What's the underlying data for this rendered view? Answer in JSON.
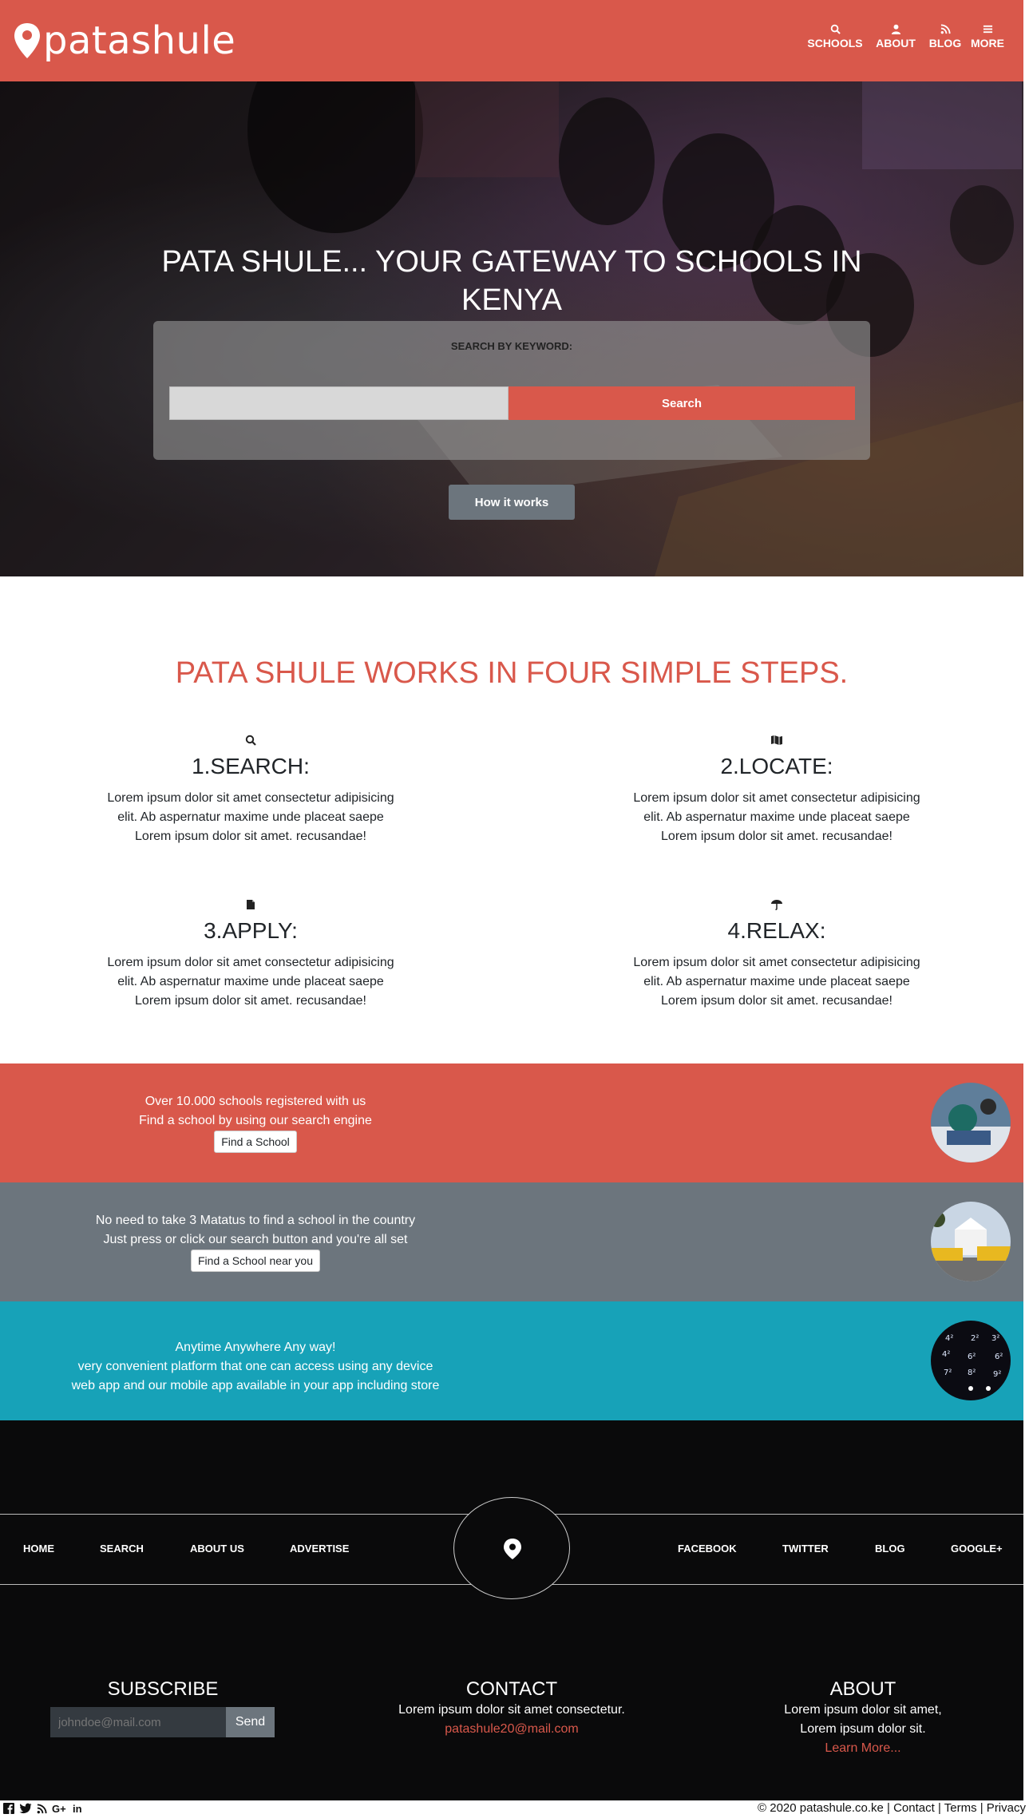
{
  "brand": {
    "name": "patashule",
    "color": "#d9584b"
  },
  "nav": {
    "items": [
      {
        "label": "SCHOOLS",
        "icon": "search-icon"
      },
      {
        "label": "ABOUT",
        "icon": "user-icon"
      },
      {
        "label": "BLOG",
        "icon": "rss-icon"
      },
      {
        "label": "MORE",
        "icon": "menu-icon"
      }
    ]
  },
  "hero": {
    "title": "PATA SHULE... YOUR GATEWAY TO SCHOOLS IN KENYA",
    "search_label": "SEARCH BY KEYWORD:",
    "search_placeholder": "",
    "search_button": "Search",
    "how_button": "How it works"
  },
  "steps": {
    "title": "PATA SHULE WORKS IN FOUR SIMPLE STEPS.",
    "items": [
      {
        "heading": "1.SEARCH:",
        "icon": "search-icon",
        "text": "Lorem ipsum dolor sit amet consectetur adipisicing elit. Ab aspernatur maxime unde placeat saepe Lorem ipsum dolor sit amet. recusandae!"
      },
      {
        "heading": "2.LOCATE:",
        "icon": "map-icon",
        "text": "Lorem ipsum dolor sit amet consectetur adipisicing elit. Ab aspernatur maxime unde placeat saepe Lorem ipsum dolor sit amet. recusandae!"
      },
      {
        "heading": "3.APPLY:",
        "icon": "file-icon",
        "text": "Lorem ipsum dolor sit amet consectetur adipisicing elit. Ab aspernatur maxime unde placeat saepe Lorem ipsum dolor sit amet. recusandae!"
      },
      {
        "heading": "4.RELAX:",
        "icon": "umbrella-icon",
        "text": "Lorem ipsum dolor sit amet consectetur adipisicing elit. Ab aspernatur maxime unde placeat saepe Lorem ipsum dolor sit amet. recusandae!"
      }
    ]
  },
  "bands": [
    {
      "color": "#d9584b",
      "line1": "Over 10.000 schools registered with us",
      "line2": "Find a school by using our search engine",
      "button": "Find a School"
    },
    {
      "color": "#6c757d",
      "line1": "No need to take 3 Matatus to find a school in the country",
      "line2": "Just press or click our search button and you're all set",
      "button": "Find a School near you"
    },
    {
      "color": "#17a2b8",
      "line1": "Anytime Anywhere Any way!",
      "line2": "very convenient platform that one can access using any device",
      "line3": "web app and our mobile app available in your app including store"
    }
  ],
  "footer": {
    "links_left": [
      "HOME",
      "SEARCH",
      "ABOUT US",
      "ADVERTISE"
    ],
    "links_right": [
      "FACEBOOK",
      "TWITTER",
      "BLOG",
      "GOOGLE+"
    ],
    "subscribe": {
      "title": "SUBSCRIBE",
      "placeholder": "johndoe@mail.com",
      "button": "Send"
    },
    "contact": {
      "title": "CONTACT",
      "text": "Lorem ipsum dolor sit amet consectetur.",
      "email": "patashule20@mail.com"
    },
    "about": {
      "title": "ABOUT",
      "line1": "Lorem ipsum dolor sit amet,",
      "line2": "Lorem ipsum dolor sit.",
      "link": "Learn More..."
    }
  },
  "bottom": {
    "copyright": "© 2020 patashule.co.ke | Contact | Terms | Privacy",
    "social": [
      "facebook-icon",
      "twitter-icon",
      "rss-icon",
      "google-plus-icon",
      "linkedin-icon"
    ]
  }
}
